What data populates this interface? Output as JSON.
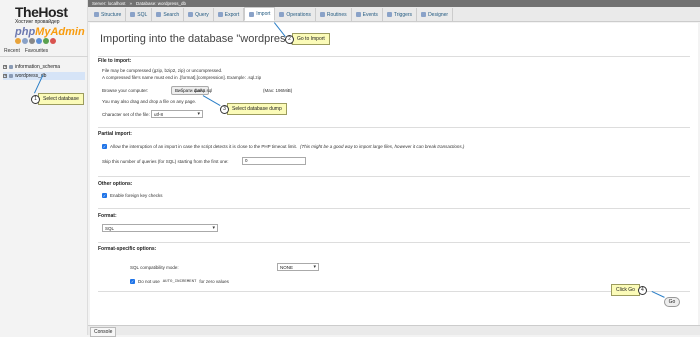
{
  "sidebar": {
    "logo_title": "TheHost",
    "logo_subtitle": "Хостинг провайдер",
    "logo_pma_a": "php",
    "logo_pma_b": "MyAdmin",
    "tabs": [
      "Recent",
      "Favourites"
    ],
    "databases": [
      "information_schema",
      "wordpress_db"
    ]
  },
  "breadcrumb": {
    "server": "Server: localhost",
    "database": "Database: wordpress_db"
  },
  "tabs": [
    {
      "label": "Structure",
      "icon": "structure-icon"
    },
    {
      "label": "SQL",
      "icon": "sql-icon"
    },
    {
      "label": "Search",
      "icon": "search-icon"
    },
    {
      "label": "Query",
      "icon": "query-icon"
    },
    {
      "label": "Export",
      "icon": "export-icon"
    },
    {
      "label": "Import",
      "icon": "import-icon"
    },
    {
      "label": "Operations",
      "icon": "wrench-icon"
    },
    {
      "label": "Routines",
      "icon": "routines-icon"
    },
    {
      "label": "Events",
      "icon": "clock-icon"
    },
    {
      "label": "Triggers",
      "icon": "triggers-icon"
    },
    {
      "label": "Designer",
      "icon": "designer-icon"
    }
  ],
  "active_tab": "Import",
  "main": {
    "title": "Importing into the database \"wordpress_db\"",
    "file_section": {
      "heading": "File to import:",
      "line1": "File may be compressed (gzip, bzip2, zip) or uncompressed.",
      "line2": "A compressed file's name must end in .[format].[compression]. Example: .sql.zip",
      "browse_label": "Browse your computer:",
      "browse_button": "Вибрати файл",
      "file_name": "dump.sql",
      "max_size": "(Max: 196MiB)",
      "drag_text": "You may also drag and drop a file on any page.",
      "charset_label": "Character set of the file:",
      "charset_value": "utf-8"
    },
    "partial_section": {
      "heading": "Partial import:",
      "interrupt_text": "Allow the interruption of an import in case the script detects it is close to the PHP timeout limit.",
      "interrupt_note": "(This might be a good way to import large files, however it can break transactions.)",
      "skip_label": "Skip this number of queries (for SQL) starting from the first one:",
      "skip_value": "0"
    },
    "other_section": {
      "heading": "Other options:",
      "foreign_keys": "Enable foreign key checks"
    },
    "format_section": {
      "heading": "Format:",
      "format_value": "SQL"
    },
    "format_specific": {
      "heading": "Format-specific options:",
      "compat_label": "SQL compatibility mode:",
      "compat_value": "NONE",
      "auto_inc_a": "Do not use",
      "auto_inc_code": "AUTO_INCREMENT",
      "auto_inc_b": "for zero values"
    },
    "go_button": "Go"
  },
  "callouts": [
    {
      "num": "1",
      "label": "Select database"
    },
    {
      "num": "2",
      "label": "Go to Import"
    },
    {
      "num": "3",
      "label": "Select database dump"
    },
    {
      "num": "4",
      "label": "Click Go"
    }
  ],
  "console_label": "Console",
  "colors": {
    "accent": "#1e73e8",
    "callout_bg": "#fbfbb8",
    "link": "#235a81",
    "arrow": "#2a7ec7"
  }
}
